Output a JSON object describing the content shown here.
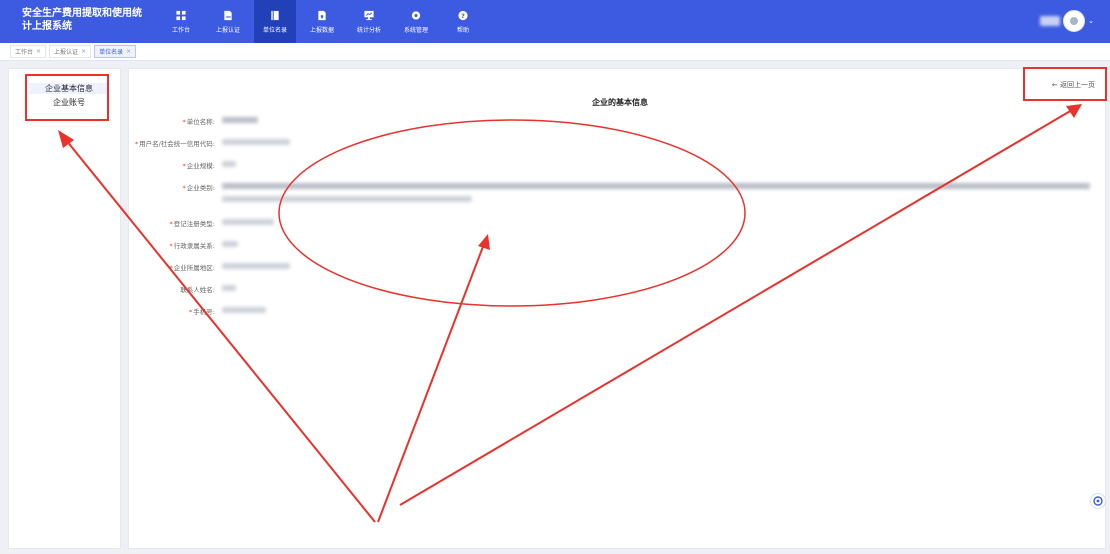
{
  "app": {
    "title": "安全生产费用提取和使用统计上报系统"
  },
  "nav": [
    {
      "label": "工作台",
      "icon": "grid-icon"
    },
    {
      "label": "上报认证",
      "icon": "document-icon"
    },
    {
      "label": "单位名录",
      "icon": "book-icon"
    },
    {
      "label": "上报数据",
      "icon": "document-upload-icon"
    },
    {
      "label": "统计分析",
      "icon": "chart-monitor-icon"
    },
    {
      "label": "系统管理",
      "icon": "gear-icon"
    },
    {
      "label": "帮助",
      "icon": "help-circle-icon"
    }
  ],
  "active_nav": "单位名录",
  "tabs": [
    {
      "label": "工作台",
      "close": "×"
    },
    {
      "label": "上报认证",
      "close": "×"
    },
    {
      "label": "单位名录",
      "close": "×"
    }
  ],
  "sidebar": {
    "items": [
      {
        "label": "企业基本信息"
      },
      {
        "label": "企业账号"
      }
    ]
  },
  "main": {
    "back_label": "← 返回上一页",
    "title": "企业的基本信息",
    "fields": [
      {
        "label": "单位名称:",
        "required": "*"
      },
      {
        "label": "用户名/社会统一信用代码:",
        "required": "*"
      },
      {
        "label": "企业规模:",
        "required": "*"
      },
      {
        "label": "企业类别:",
        "required": "*"
      },
      {
        "label": "登记注册类型:",
        "required": "*"
      },
      {
        "label": "行政隶属关系:",
        "required": "*"
      },
      {
        "label": "企业所属地区:",
        "required": "*"
      },
      {
        "label": "联系人姓名:",
        "required": ""
      },
      {
        "label": "手机号:",
        "required": "*"
      }
    ]
  },
  "user": {
    "caret": "⌄"
  },
  "colors": {
    "brand": "#3d5be0",
    "nav_active": "#2241b8",
    "annotation": "#e8322b"
  }
}
